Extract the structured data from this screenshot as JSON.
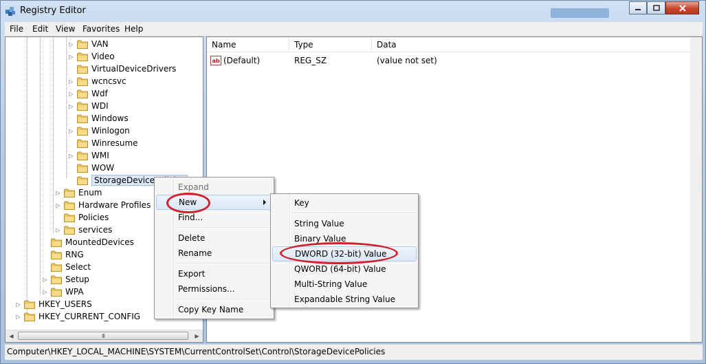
{
  "window": {
    "title": "Registry Editor",
    "buttons": {
      "minimize": "minimize",
      "maximize": "maximize",
      "close": "close"
    }
  },
  "menu": [
    "File",
    "Edit",
    "View",
    "Favorites",
    "Help"
  ],
  "tree": [
    {
      "label": "VAN",
      "expander": true
    },
    {
      "label": "Video",
      "expander": true
    },
    {
      "label": "VirtualDeviceDrivers",
      "expander": false
    },
    {
      "label": "wcncsvc",
      "expander": true
    },
    {
      "label": "Wdf",
      "expander": true
    },
    {
      "label": "WDI",
      "expander": true
    },
    {
      "label": "Windows",
      "expander": false
    },
    {
      "label": "Winlogon",
      "expander": true
    },
    {
      "label": "Winresume",
      "expander": false
    },
    {
      "label": "WMI",
      "expander": true
    },
    {
      "label": "WOW",
      "expander": false
    },
    {
      "label": "StorageDevicePolicies",
      "expander": false,
      "selected": true
    },
    {
      "label": "Enum",
      "expander": true
    },
    {
      "label": "Hardware Profiles",
      "expander": true
    },
    {
      "label": "Policies",
      "expander": false
    },
    {
      "label": "services",
      "expander": true
    },
    {
      "label": "MountedDevices",
      "expander": false
    },
    {
      "label": "RNG",
      "expander": false
    },
    {
      "label": "Select",
      "expander": false
    },
    {
      "label": "Setup",
      "expander": true
    },
    {
      "label": "WPA",
      "expander": true
    },
    {
      "label": "HKEY_USERS",
      "expander": true
    },
    {
      "label": "HKEY_CURRENT_CONFIG",
      "expander": true
    }
  ],
  "list": {
    "columns": [
      "Name",
      "Type",
      "Data"
    ],
    "rows": [
      {
        "name": "(Default)",
        "type": "REG_SZ",
        "data": "(value not set)",
        "icon": "string-value-icon"
      }
    ]
  },
  "context_menu": {
    "items": [
      "Expand",
      "New",
      "Find...",
      "Delete",
      "Rename",
      "Export",
      "Permissions...",
      "Copy Key Name"
    ]
  },
  "submenu": {
    "items": [
      "Key",
      "String Value",
      "Binary Value",
      "DWORD (32-bit) Value",
      "QWORD (64-bit) Value",
      "Multi-String Value",
      "Expandable String Value"
    ]
  },
  "status": "Computer\\HKEY_LOCAL_MACHINE\\SYSTEM\\CurrentControlSet\\Control\\StorageDevicePolicies",
  "colors": {
    "highlight_ring": "#d0202a",
    "folder": "#e8c560"
  }
}
